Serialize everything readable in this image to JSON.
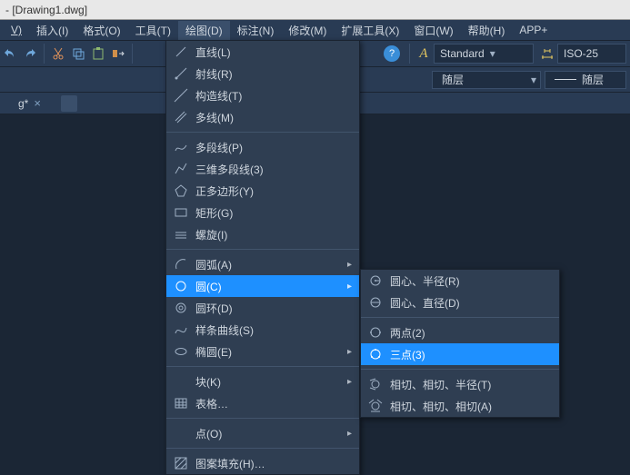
{
  "title": "- [Drawing1.dwg]",
  "menus": {
    "view": "V)",
    "insert": "插入(I)",
    "format": "格式(O)",
    "tools": "工具(T)",
    "draw": "绘图(D)",
    "dim": "标注(N)",
    "modify": "修改(M)",
    "ext": "扩展工具(X)",
    "window": "窗口(W)",
    "help": "帮助(H)",
    "app": "APP+"
  },
  "styles": {
    "text": "Standard",
    "dim": "ISO-25"
  },
  "layer": {
    "name": "随层",
    "line": "随层"
  },
  "tab": {
    "name": "g*"
  },
  "draw_menu": {
    "line": "直线(L)",
    "ray": "射线(R)",
    "xline": "构造线(T)",
    "mline": "多线(M)",
    "pline": "多段线(P)",
    "p3d": "三维多段线(3)",
    "polygon": "正多边形(Y)",
    "rect": "矩形(G)",
    "spiral": "螺旋(I)",
    "arc": "圆弧(A)",
    "circle": "圆(C)",
    "donut": "圆环(D)",
    "spline": "样条曲线(S)",
    "ellipse": "椭圆(E)",
    "block": "块(K)",
    "table": "表格…",
    "point": "点(O)",
    "hatch": "图案填充(H)…"
  },
  "circle_menu": {
    "cr": "圆心、半径(R)",
    "cd": "圆心、直径(D)",
    "p2": "两点(2)",
    "p3": "三点(3)",
    "ttr": "相切、相切、半径(T)",
    "ttt": "相切、相切、相切(A)"
  }
}
